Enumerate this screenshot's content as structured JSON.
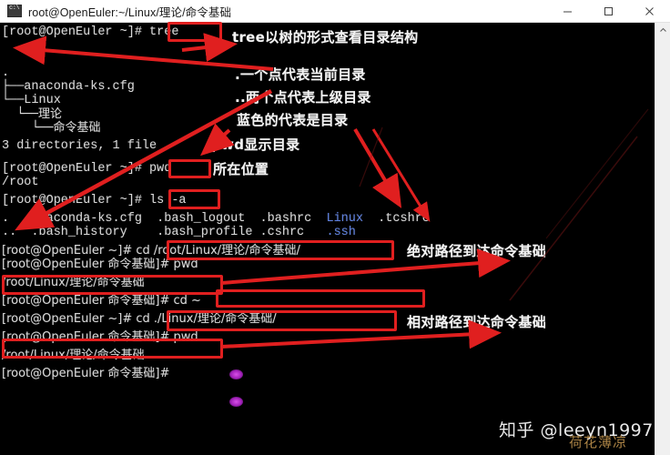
{
  "window": {
    "title": "root@OpenEuler:~/Linux/理论/命令基础",
    "icon_name": "console-icon",
    "minimize_label": "—",
    "maximize_label": "☐",
    "close_label": "✕"
  },
  "scrollbar": {
    "up_arrow": "⌃"
  },
  "terminal": {
    "prompt_root": "[root@OpenEuler ~]# ",
    "prompt_cmd": "[root@OpenEuler 命令基础]# ",
    "lines": [
      {
        "id": "l01",
        "text": "[root@OpenEuler ~]# tree"
      },
      {
        "id": "l02",
        "text": "."
      },
      {
        "id": "l03",
        "text": "├──anaconda-ks.cfg"
      },
      {
        "id": "l04",
        "text": "└──Linux"
      },
      {
        "id": "l05",
        "text": "    └──理论"
      },
      {
        "id": "l06",
        "text": "        └──命令基础"
      },
      {
        "id": "l07",
        "text": ""
      },
      {
        "id": "l08",
        "text": "3 directories, 1 file"
      },
      {
        "id": "l09",
        "text": "[root@OpenEuler ~]# pwd"
      },
      {
        "id": "l10",
        "text": "/root"
      },
      {
        "id": "l11",
        "text": "[root@OpenEuler ~]# ls -a"
      },
      {
        "id": "l12a",
        "text": ".   anaconda-ks.cfg  .bash_logout  .bashrc  "
      },
      {
        "id": "l12b",
        "text": "Linux"
      },
      {
        "id": "l12c",
        "text": "  .tcshrc"
      },
      {
        "id": "l13a",
        "text": "..  .bash_history    .bash_profile .cshrc   "
      },
      {
        "id": "l13b",
        "text": ".ssh"
      },
      {
        "id": "l14",
        "text": "[root@OpenEuler ~]# cd /root/Linux/理论/命令基础/"
      },
      {
        "id": "l15",
        "text": "[root@OpenEuler 命令基础]# pwd"
      },
      {
        "id": "l16",
        "text": "/root/Linux/理论/命令基础"
      },
      {
        "id": "l17",
        "text": "[root@OpenEuler 命令基础]# cd ~"
      },
      {
        "id": "l18",
        "text": "[root@OpenEuler ~]# cd ./Linux/理论/命令基础/"
      },
      {
        "id": "l19",
        "text": "[root@OpenEuler 命令基础]# pwd"
      },
      {
        "id": "l20",
        "text": "/root/Linux/理论/命令基础"
      },
      {
        "id": "l21",
        "text": "[root@OpenEuler 命令基础]# "
      }
    ],
    "blue_entries": [
      "Linux",
      ".ssh"
    ],
    "colors": {
      "background": "#000000",
      "foreground": "#d8d8d8",
      "directory_blue": "#5c7fe0",
      "cursor_purple": "#c33fd8"
    }
  },
  "annotations": {
    "accent_color": "#e01f1f",
    "notes": [
      {
        "id": "n1",
        "text": "tree以树的形式查看目录结构"
      },
      {
        "id": "n2",
        "text": ".一个点代表当前目录"
      },
      {
        "id": "n3",
        "text": "..两个点代表上级目录"
      },
      {
        "id": "n4",
        "text": "蓝色的代表是目录"
      },
      {
        "id": "n5",
        "text": "pwd显示目录"
      },
      {
        "id": "n6",
        "text": "所在位置"
      },
      {
        "id": "n7",
        "text": "绝对路径到达命令基础"
      },
      {
        "id": "n8",
        "text": "相对路径到达命令基础"
      }
    ],
    "highlight_boxes": [
      {
        "id": "b1",
        "target": "tree"
      },
      {
        "id": "b2",
        "target": "pwd"
      },
      {
        "id": "b3",
        "target": "ls -a"
      },
      {
        "id": "b4",
        "target": "cd /root/Linux/理论/命令基础/"
      },
      {
        "id": "b5",
        "target": "/root/Linux/理论/命令基础"
      },
      {
        "id": "b6",
        "target": "cd ~"
      },
      {
        "id": "b7",
        "target": "cd ./Linux/理论/命令基础/"
      },
      {
        "id": "b8",
        "target": "/root/Linux/理论/命令基础"
      }
    ]
  },
  "watermark": {
    "text": "知乎 @leeyn1997",
    "sub_text": "荷花薄凉"
  }
}
